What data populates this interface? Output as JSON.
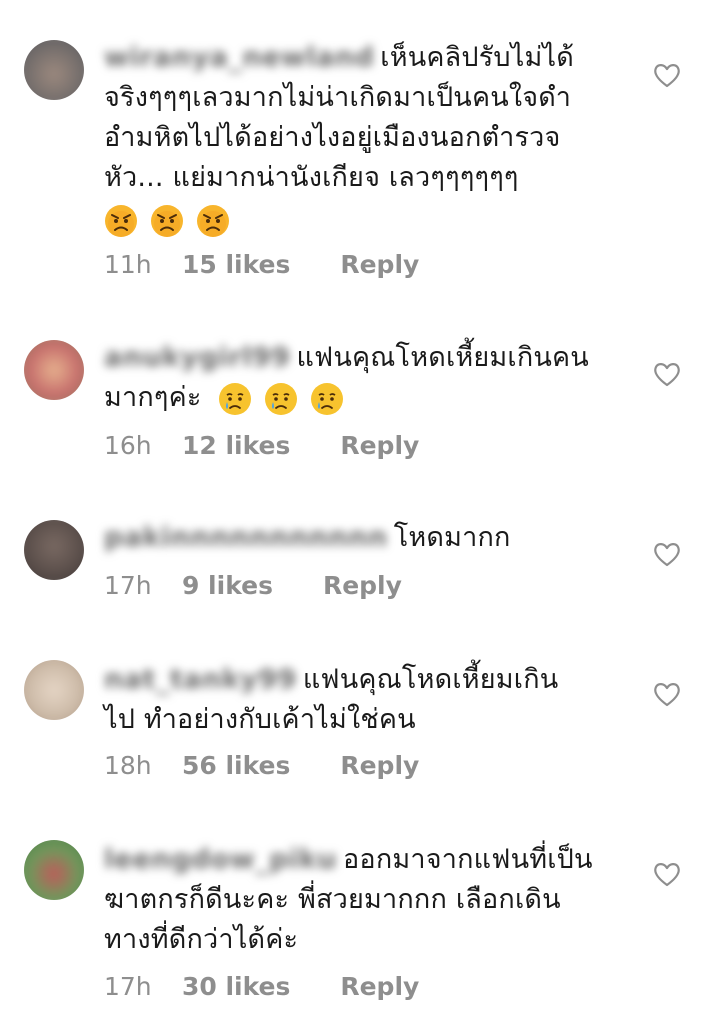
{
  "comments": [
    {
      "username": "wiranya_newland",
      "line1": "เห็นคลิปรับไม่ได้",
      "line2": "จริงๆๆๆเลวมากไม่น่าเกิดมาเป็นคนใจดำ",
      "line3": "อำมหิตไปได้อย่างไงอยู่เมืองนอกตำรวจ",
      "line4": "หัว... แย่มากน่านังเกียจ เลวๆๆๆๆๆๆ",
      "emoji_icon": "angry-face-icon",
      "time": "11h",
      "likes": "15 likes",
      "reply": "Reply",
      "avatar_color": "#6f6a69"
    },
    {
      "username": "anukygirl99",
      "line1": "แฟนคุณโหดเหี้ยมเกินคน",
      "line2": "มากๆค่ะ",
      "emoji_icon": "crying-face-icon",
      "time": "16h",
      "likes": "12 likes",
      "reply": "Reply",
      "avatar_color": "#c46a6a"
    },
    {
      "username": "pakinnnnnnnnnnn",
      "line1": "โหดมากก",
      "time": "17h",
      "likes": "9 likes",
      "reply": "Reply",
      "avatar_color": "#5a4e4a"
    },
    {
      "username": "nat_tanky99",
      "line1": "แฟนคุณโหดเหี้ยมเกิน",
      "line2": "ไป ทำอย่างกับเค้าไม่ใช่คน",
      "time": "18h",
      "likes": "56 likes",
      "reply": "Reply",
      "avatar_color": "#c9b7a4"
    },
    {
      "username": "leengdow_piku",
      "line1": "ออกมาจากแฟนที่เป็น",
      "line2": "ฆาตกรก็ดีนะคะ พี่สวยมากกก เลือกเดิน",
      "line3": "ทางที่ดีกว่าได้ค่ะ",
      "time": "17h",
      "likes": "30 likes",
      "reply": "Reply",
      "avatar_color": "#6f9a5c"
    }
  ],
  "heart_icon": "heart-outline-icon",
  "colors": {
    "text": "#1a1a1a",
    "meta": "#8e8e8e",
    "emoji_yellow": "#f7c32e",
    "emoji_angry": "#ee9a2a"
  }
}
